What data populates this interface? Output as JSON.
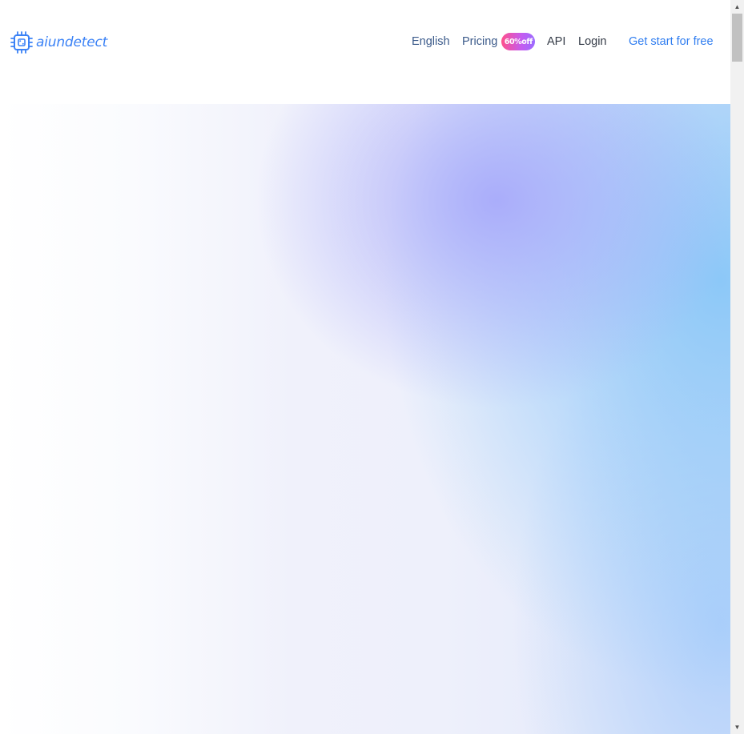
{
  "brand": {
    "name": "aiundetect",
    "logo_icon": "chip-icon",
    "color": "#3b82f6"
  },
  "nav": {
    "language": "English",
    "pricing": "Pricing",
    "pricing_badge": "60%off",
    "api": "API",
    "login": "Login",
    "cta": "Get start for free"
  },
  "colors": {
    "accent": "#2f7df0",
    "nav_text": "#3b5a8a",
    "badge_gradient": [
      "#ff4f8b",
      "#9a6bff"
    ]
  }
}
